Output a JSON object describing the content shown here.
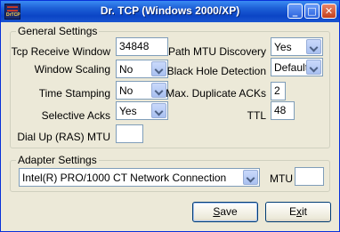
{
  "window": {
    "title": "Dr. TCP (Windows 2000/XP)",
    "minimize_glyph": "_",
    "maximize_glyph": "□",
    "close_glyph": "✕"
  },
  "app_icon": {
    "text": "DrTCP"
  },
  "general": {
    "title": "General Settings",
    "tcp_receive_window": {
      "label": "Tcp Receive Window",
      "value": "34848"
    },
    "window_scaling": {
      "label": "Window Scaling",
      "value": "No"
    },
    "time_stamping": {
      "label": "Time Stamping",
      "value": "No"
    },
    "selective_acks": {
      "label": "Selective Acks",
      "value": "Yes"
    },
    "dial_up_mtu": {
      "label": "Dial Up (RAS) MTU",
      "value": ""
    },
    "path_mtu_discovery": {
      "label": "Path MTU Discovery",
      "value": "Yes"
    },
    "black_hole_detection": {
      "label": "Black Hole Detection",
      "value": "Default"
    },
    "max_duplicate_acks": {
      "label": "Max. Duplicate ACKs",
      "value": "2"
    },
    "ttl": {
      "label": "TTL",
      "value": "48"
    }
  },
  "adapter": {
    "title": "Adapter Settings",
    "selected": "Intel(R) PRO/1000 CT Network Connection",
    "mtu_label": "MTU",
    "mtu_value": ""
  },
  "buttons": {
    "save_mnemonic": "S",
    "save_rest": "ave",
    "exit_pre": "E",
    "exit_mnemonic": "x",
    "exit_rest": "it"
  }
}
